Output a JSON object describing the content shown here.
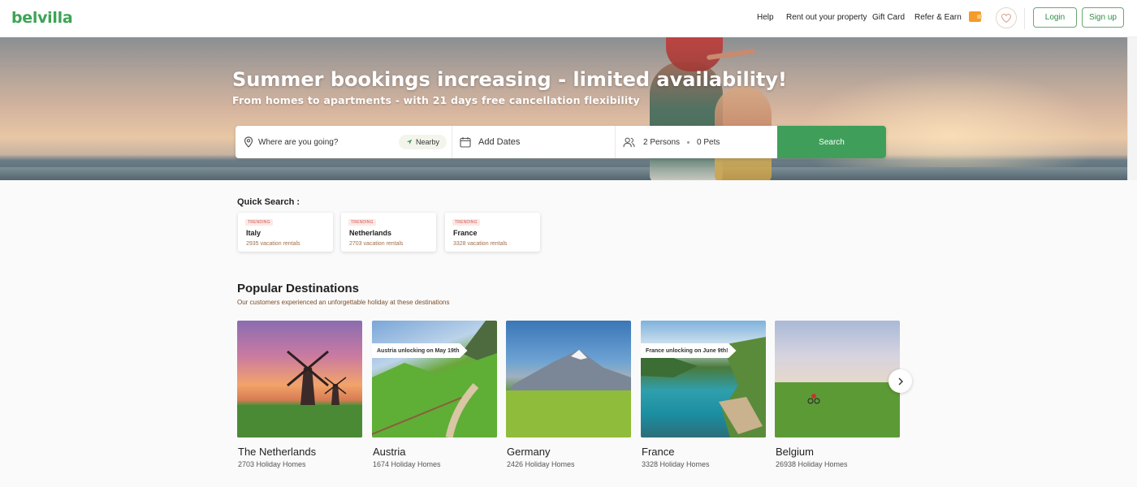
{
  "header": {
    "logo": "belvilla",
    "nav": [
      "Help",
      "Rent out your property",
      "Gift Card",
      "Refer & Earn"
    ],
    "login": "Login",
    "signup": "Sign up"
  },
  "hero": {
    "title": "Summer bookings increasing - limited availability!",
    "subtitle": "From homes to apartments - with 21 days free cancellation flexibility"
  },
  "search": {
    "destination_placeholder": "Where are you going?",
    "nearby": "Nearby",
    "dates_placeholder": "Add Dates",
    "persons": "2 Persons",
    "pets": "0 Pets",
    "button": "Search"
  },
  "quick_search": {
    "title": "Quick Search :",
    "items": [
      {
        "badge": "TRENDING",
        "name": "Italy",
        "count": "2935 vacation rentals"
      },
      {
        "badge": "TRENDING",
        "name": "Netherlands",
        "count": "2703 vacation rentals"
      },
      {
        "badge": "TRENDING",
        "name": "France",
        "count": "3328 vacation rentals"
      }
    ]
  },
  "popular": {
    "title": "Popular Destinations",
    "subtitle": "Our customers experienced an unforgettable holiday at these destinations",
    "items": [
      {
        "name": "The Netherlands",
        "count": "2703 Holiday Homes",
        "tag": ""
      },
      {
        "name": "Austria",
        "count": "1674 Holiday Homes",
        "tag": "Austria unlocking on May 19th"
      },
      {
        "name": "Germany",
        "count": "2426 Holiday Homes",
        "tag": ""
      },
      {
        "name": "France",
        "count": "3328 Holiday Homes",
        "tag": "France unlocking on June 9th!"
      },
      {
        "name": "Belgium",
        "count": "26938 Holiday Homes",
        "tag": ""
      }
    ]
  },
  "colors": {
    "brand": "#3ea356",
    "search_button": "#3f9f5a",
    "trending": "#d2544f"
  },
  "icons": [
    "location-pin-icon",
    "navigation-arrow-icon",
    "calendar-icon",
    "persons-icon",
    "wallet-icon",
    "heart-icon",
    "chevron-right-icon"
  ]
}
